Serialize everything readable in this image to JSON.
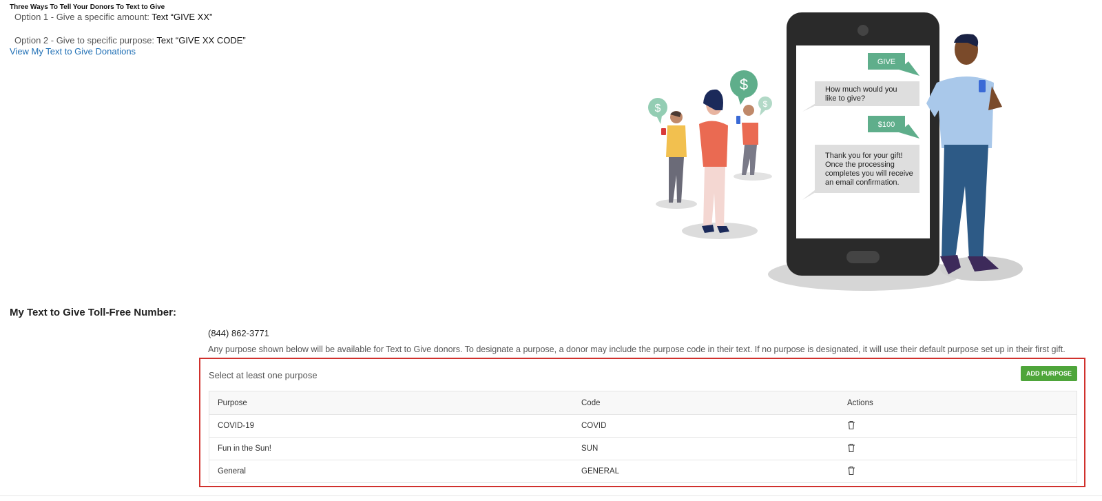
{
  "intro": {
    "title": "Three Ways To Tell Your Donors To Text to Give",
    "options": [
      {
        "prefix": "Option 1 - Give a specific amount: ",
        "text": "Text “GIVE XX”"
      },
      {
        "prefix": "Option 2 - Give to specific purpose: ",
        "text": "Text “GIVE XX CODE”"
      }
    ],
    "view_link": "View My Text to Give Donations"
  },
  "illustration": {
    "bubbles": [
      "GIVE",
      "How much would you",
      "like to give?",
      "$100",
      "Thank you for your gift!",
      "Once the processing",
      "completes you will receive",
      "an email confirmation."
    ],
    "icons": [
      "dollar-icon"
    ],
    "colors": {
      "green": "#5fae8b",
      "phone": "#2a2a2a",
      "bubble_gray": "#dedede"
    }
  },
  "tollfree": {
    "label": "My Text to Give Toll-Free Number:",
    "number": "(844) 862-3771",
    "description": "Any purpose shown below will be available for Text to Give donors. To designate a purpose, a donor may include the purpose code in their text. If no purpose is designated, it will use their default purpose set up in their first gift."
  },
  "purposes": {
    "select_label": "Select at least one purpose",
    "add_button": "ADD PURPOSE",
    "headers": [
      "Purpose",
      "Code",
      "Actions"
    ],
    "rows": [
      {
        "purpose": "COVID-19",
        "code": "COVID"
      },
      {
        "purpose": "Fun in the Sun!",
        "code": "SUN"
      },
      {
        "purpose": "General",
        "code": "GENERAL"
      }
    ]
  },
  "colors": {
    "link": "#1f6fb5",
    "highlight_border": "#d0312d",
    "add_button": "#4ea53a"
  }
}
